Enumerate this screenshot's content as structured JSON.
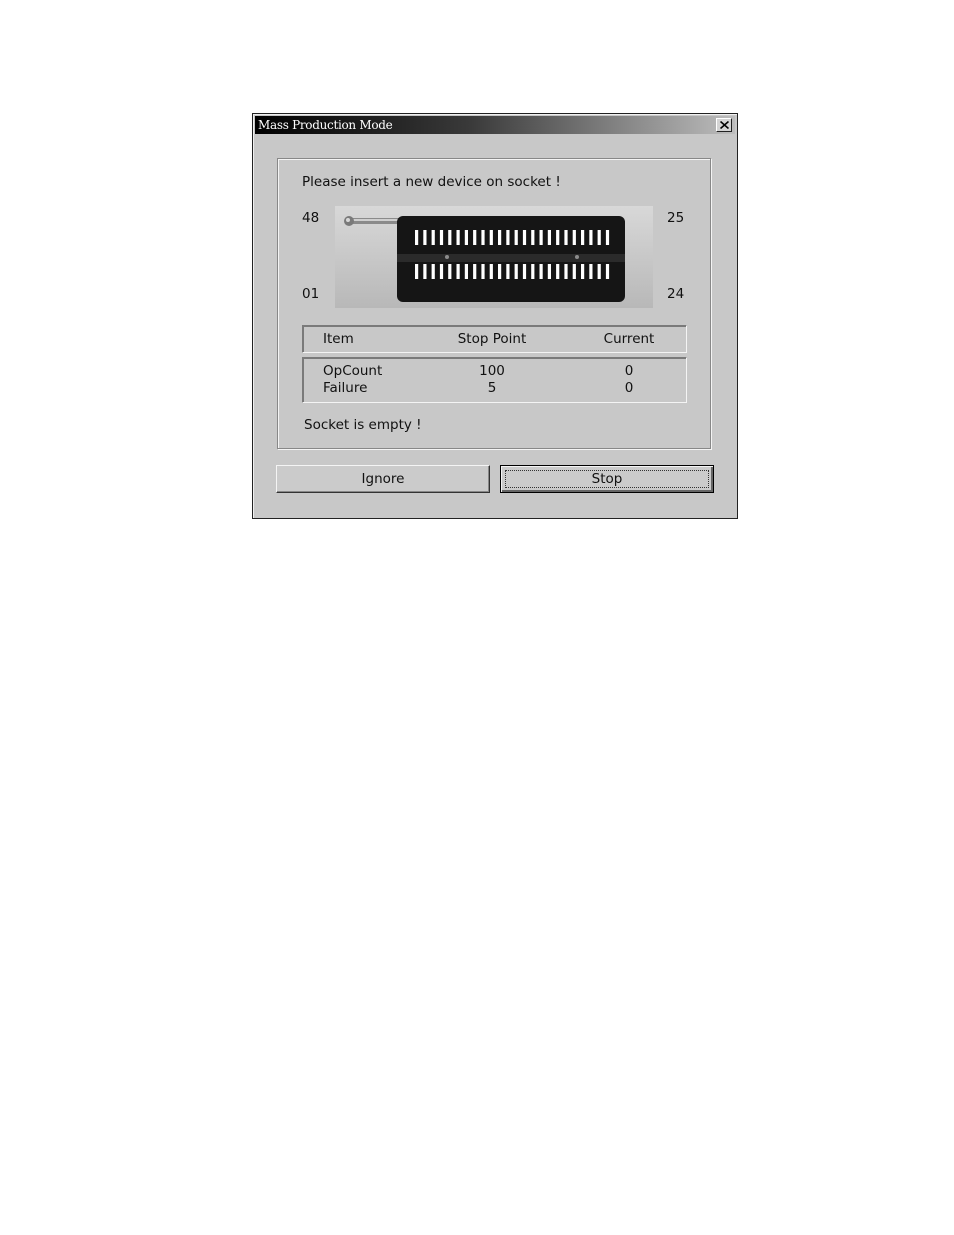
{
  "window": {
    "title": "Mass Production Mode",
    "close_label": "close"
  },
  "dialog": {
    "instruction": "Please insert a new device on socket !",
    "socket": {
      "pin_top_left": "48",
      "pin_bottom_left": "01",
      "pin_top_right": "25",
      "pin_bottom_right": "24",
      "icon": "zif-socket-48-pin"
    },
    "table": {
      "headers": [
        "Item",
        "Stop Point",
        "Current"
      ],
      "rows": [
        {
          "item": "OpCount",
          "stop_point": "100",
          "current": "0"
        },
        {
          "item": "Failure",
          "stop_point": "5",
          "current": "0"
        }
      ]
    },
    "status": "Socket is empty !"
  },
  "buttons": {
    "ignore": "Ignore",
    "stop": "Stop"
  },
  "colors": {
    "dialog_bg": "#c8c8c8",
    "titlebar_start": "#000000",
    "titlebar_end": "#bdbdbd"
  }
}
